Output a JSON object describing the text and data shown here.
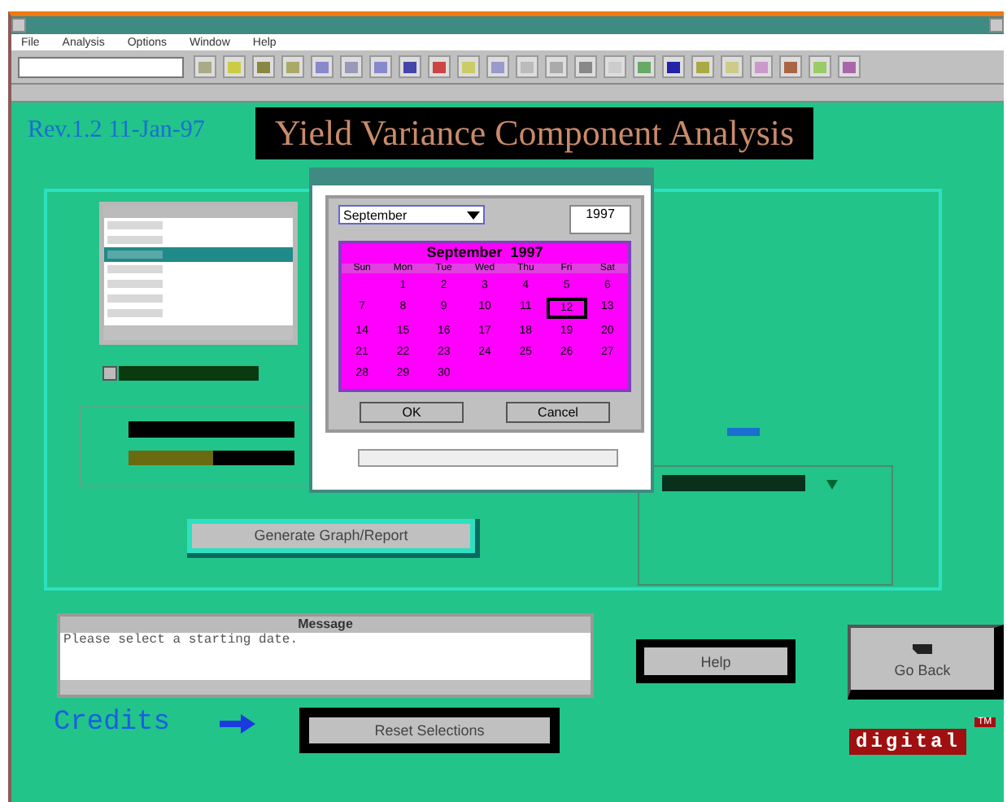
{
  "menu": [
    {
      "label": "File"
    },
    {
      "label": "Analysis"
    },
    {
      "label": "Options"
    },
    {
      "label": "Window"
    },
    {
      "label": "Help"
    }
  ],
  "header": {
    "version": "Rev.1.2 11-Jan-97",
    "title": "Yield Variance Component Analysis"
  },
  "list": {
    "items": [
      {
        "selected": false
      },
      {
        "selected": false
      },
      {
        "selected": true
      },
      {
        "selected": false
      },
      {
        "selected": false
      },
      {
        "selected": false
      },
      {
        "selected": false
      }
    ]
  },
  "checkbox": {
    "checked": false
  },
  "date_dialog": {
    "month": "September",
    "year": "1997",
    "heading": "September  1997",
    "weekdays": [
      "Sun",
      "Mon",
      "Tue",
      "Wed",
      "Thu",
      "Fri",
      "Sat"
    ],
    "weeks": [
      {
        "days": [
          {
            "label": "1",
            "selected": false
          },
          {
            "label": "2",
            "selected": false
          },
          {
            "label": "3",
            "selected": false
          },
          {
            "label": "4",
            "selected": false
          },
          {
            "label": "5",
            "selected": false
          },
          {
            "label": "6",
            "selected": false
          }
        ]
      },
      {
        "days": [
          {
            "label": "7",
            "selected": false
          },
          {
            "label": "8",
            "selected": false
          },
          {
            "label": "9",
            "selected": false
          },
          {
            "label": "10",
            "selected": false
          },
          {
            "label": "11",
            "selected": false
          },
          {
            "label": "12",
            "selected": true
          },
          {
            "label": "13",
            "selected": false
          }
        ]
      },
      {
        "days": [
          {
            "label": "14",
            "selected": false
          },
          {
            "label": "15",
            "selected": false
          },
          {
            "label": "16",
            "selected": false
          },
          {
            "label": "17",
            "selected": false
          },
          {
            "label": "18",
            "selected": false
          },
          {
            "label": "19",
            "selected": false
          },
          {
            "label": "20",
            "selected": false
          }
        ]
      },
      {
        "days": [
          {
            "label": "21",
            "selected": false
          },
          {
            "label": "22",
            "selected": false
          },
          {
            "label": "23",
            "selected": false
          },
          {
            "label": "24",
            "selected": false
          },
          {
            "label": "25",
            "selected": false
          },
          {
            "label": "26",
            "selected": false
          },
          {
            "label": "27",
            "selected": false
          }
        ]
      },
      {
        "days": [
          {
            "label": "28",
            "selected": false
          },
          {
            "label": "29",
            "selected": false
          },
          {
            "label": "30",
            "selected": false
          }
        ]
      }
    ],
    "buttons": [
      "OK",
      "Cancel"
    ]
  },
  "generate_button": "Generate Graph/Report",
  "messages": {
    "title": "Message",
    "text": "Please select a starting date."
  },
  "help_button": "Help",
  "back_button": "Go Back",
  "credits": "Credits",
  "reset_button": "Reset Selections",
  "logo": {
    "name": "digital",
    "mark": "TM"
  }
}
